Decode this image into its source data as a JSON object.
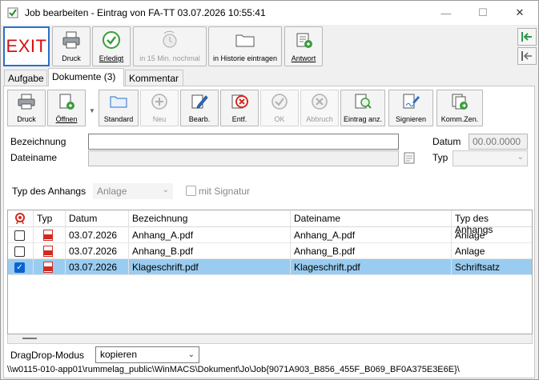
{
  "window": {
    "title": "Job bearbeiten - Eintrag von FA-TT 03.07.2026 10:55:41",
    "controls": {
      "minimize": "—",
      "maximize": "☐",
      "close": "✕"
    }
  },
  "toolbar": {
    "exit_label": "EXIT",
    "print_label": "Druck",
    "done_label": "Erledigt",
    "later_label": "in 15 Min. nochmal",
    "history_label": "in Historie eintragen",
    "reply_label": "Antwort"
  },
  "tabs": [
    {
      "label": "Aufgabe"
    },
    {
      "label": "Dokumente (3)"
    },
    {
      "label": "Kommentar"
    }
  ],
  "doc_toolbar": {
    "print_label": "Druck",
    "open_label": "Öffnen",
    "standard_label": "Standard",
    "new_label": "Neu",
    "edit_label": "Bearb.",
    "delete_label": "Entf.",
    "ok_label": "OK",
    "cancel_label": "Abbruch",
    "entry_label": "Eintrag anz.",
    "sign_label": "Signieren",
    "comm_label": "Komm.Zen."
  },
  "form": {
    "bezeichnung_label": "Bezeichnung",
    "bezeichnung_value": "",
    "dateiname_label": "Dateiname",
    "dateiname_value": "",
    "datum_label": "Datum",
    "datum_value": "00.00.0000",
    "typ_label": "Typ",
    "typ_value": "",
    "anhang_label": "Typ des Anhangs",
    "anhang_value": "Anlage",
    "signatur_label": "mit Signatur"
  },
  "grid": {
    "columns": [
      "",
      "Typ",
      "Datum",
      "Bezeichnung",
      "Dateiname",
      "Typ des Anhangs"
    ],
    "rows": [
      {
        "checked": false,
        "datum": "03.07.2026",
        "bezeichnung": "Anhang_A.pdf",
        "dateiname": "Anhang_A.pdf",
        "typ": "Anlage",
        "selected": false
      },
      {
        "checked": false,
        "datum": "03.07.2026",
        "bezeichnung": "Anhang_B.pdf",
        "dateiname": "Anhang_B.pdf",
        "typ": "Anlage",
        "selected": false
      },
      {
        "checked": true,
        "datum": "03.07.2026",
        "bezeichnung": "Klageschrift.pdf",
        "dateiname": "Klageschrift.pdf",
        "typ": "Schriftsatz",
        "selected": true
      }
    ]
  },
  "footer": {
    "dragdrop_label": "DragDrop-Modus",
    "dragdrop_value": "kopieren",
    "path": "\\\\w0115-010-app01\\rummelag_public\\WinMACS\\Dokument\\Jo\\Job{9071A903_B856_455F_B069_BF0A375E3E6E}\\"
  },
  "colors": {
    "exit_text": "#d80e0e",
    "exit_border": "#2a6fc9",
    "selected_row": "#99ccf0",
    "pdf_red": "#d42a20",
    "check_green": "#3b9c3b",
    "nav_green": "#2e9a4a"
  },
  "icons": {
    "printer": "printer-icon",
    "check": "check-circle-icon",
    "folder": "folder-icon",
    "pdf": "pdf-icon"
  }
}
